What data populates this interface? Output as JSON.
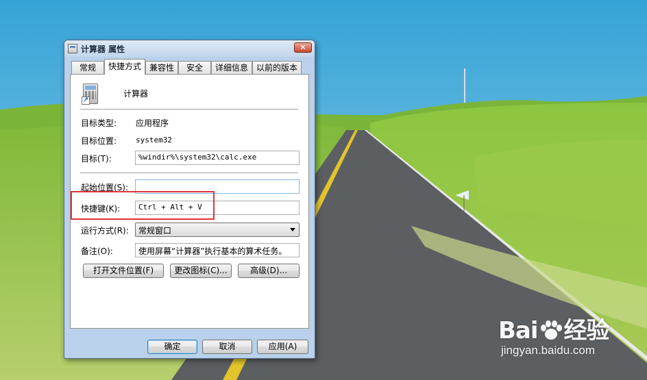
{
  "window": {
    "title": "计算器 属性",
    "close_label": "✕"
  },
  "tabs": [
    {
      "label": "常规",
      "active": false
    },
    {
      "label": "快捷方式",
      "active": true
    },
    {
      "label": "兼容性",
      "active": false
    },
    {
      "label": "安全",
      "active": false
    },
    {
      "label": "详细信息",
      "active": false
    },
    {
      "label": "以前的版本",
      "active": false
    }
  ],
  "shortcut": {
    "app_name": "计算器",
    "target_type_label": "目标类型:",
    "target_type_value": "应用程序",
    "target_location_label": "目标位置:",
    "target_location_value": "system32",
    "target_label": "目标(T):",
    "target_value": "%windir%\\system32\\calc.exe",
    "start_in_label": "起始位置(S):",
    "start_in_value": "",
    "hotkey_label": "快捷键(K):",
    "hotkey_value": "Ctrl + Alt + V",
    "run_label": "运行方式(R):",
    "run_value": "常规窗口",
    "comment_label": "备注(O):",
    "comment_value": "使用屏幕“计算器”执行基本的算术任务。",
    "open_location_button": "打开文件位置(F)",
    "change_icon_button": "更改图标(C)...",
    "advanced_button": "高级(D)..."
  },
  "footer": {
    "ok": "确定",
    "cancel": "取消",
    "apply": "应用(A)"
  },
  "watermark": {
    "logo_left": "Bai",
    "logo_right": "经验",
    "url": "jingyan.baidu.com"
  },
  "colors": {
    "highlight_box": "#e0323a",
    "window_frame": "#b9d1ea",
    "sky": "#3fa9d8",
    "grass": "#8fc43c",
    "road": "#5c5f61"
  }
}
